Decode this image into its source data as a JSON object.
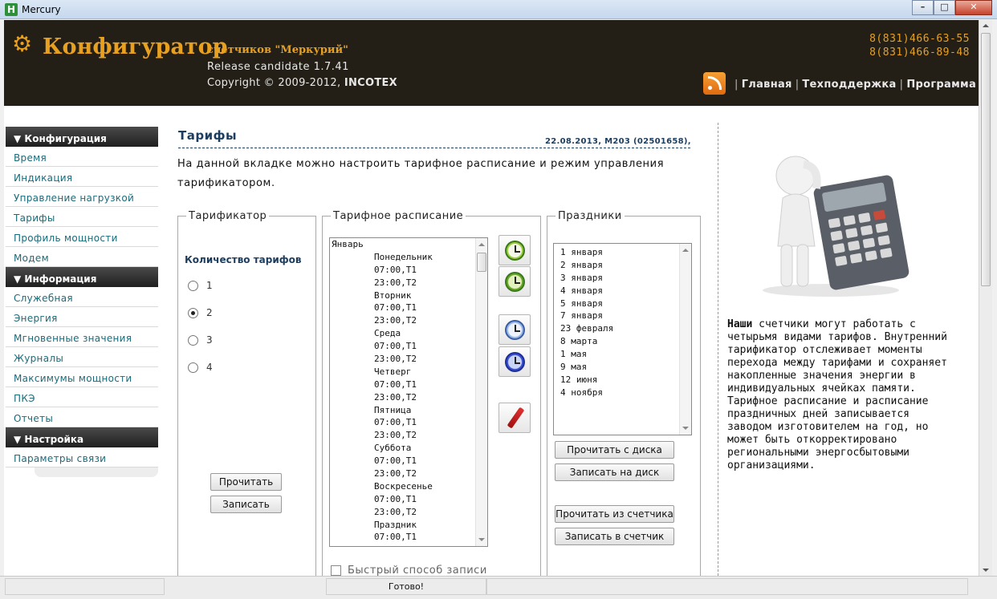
{
  "window": {
    "title": "Mercury",
    "app_icon_letter": "H",
    "buttons": {
      "minimize": "–",
      "maximize": "□",
      "close": "✕"
    }
  },
  "header": {
    "brand": "Конфигуратор",
    "subtitle": "счетчиков \"Меркурий\"",
    "release": "Release candidate 1.7.41",
    "copyright_prefix": "Copyright © 2009-2012, ",
    "copyright_company": "INCOTEX",
    "phones": [
      "8(831)466-63-55",
      "8(831)466-89-48"
    ],
    "nav": [
      "Главная",
      "Техподдержка",
      "Программа"
    ]
  },
  "sidebar": {
    "sections": [
      {
        "title": "▼ Конфигурация",
        "items": [
          "Время",
          "Индикация",
          "Управление нагрузкой",
          "Тарифы",
          "Профиль мощности",
          "Модем"
        ]
      },
      {
        "title": "▼ Информация",
        "items": [
          "Служебная",
          "Энергия",
          "Мгновенные значения",
          "Журналы",
          "Максимумы мощности",
          "ПКЭ",
          "Отчеты"
        ]
      },
      {
        "title": "▼ Настройка",
        "items": [
          "Параметры связи"
        ]
      }
    ]
  },
  "main": {
    "title": "Тарифы",
    "meta": "22.08.2013, М203 (02501658),",
    "intro": "На данной вкладке можно настроить тарифное расписание и режим управления тарификатором.",
    "tarifikator": {
      "legend": "Тарификатор",
      "qty_label": "Количество тарифов",
      "options": [
        "1",
        "2",
        "3",
        "4"
      ],
      "selected": "2",
      "read_button": "Прочитать",
      "write_button": "Записать"
    },
    "schedule": {
      "legend": "Тарифное расписание",
      "lines": [
        "Январь",
        "        Понедельник",
        "        07:00,T1",
        "        23:00,T2",
        "        Вторник",
        "        07:00,T1",
        "        23:00,T2",
        "        Среда",
        "        07:00,T1",
        "        23:00,T2",
        "        Четверг",
        "        07:00,T1",
        "        23:00,T2",
        "        Пятница",
        "        07:00,T1",
        "        23:00,T2",
        "        Суббота",
        "        07:00,T1",
        "        23:00,T2",
        "        Воскресенье",
        "        07:00,T1",
        "        23:00,T2",
        "        Праздник",
        "        07:00,T1"
      ],
      "fast_write": "Быстрый способ записи"
    },
    "holidays": {
      "legend": "Праздники",
      "items": [
        "1 января",
        "2 января",
        "3 января",
        "4 января",
        "5 января",
        "7 января",
        "23 февраля",
        "8 марта",
        "1 мая",
        "9 мая",
        "12 июня",
        "4 ноября"
      ],
      "read_disk": "Прочитать с диска",
      "write_disk": "Записать на диск",
      "read_meter": "Прочитать из счетчика",
      "write_meter": "Записать в счетчик"
    },
    "promo": {
      "bold": "Наши",
      "text": " счетчики могут работать с четырьмя видами тарифов. Внутренний тарификатор отслеживает моменты перехода между тарифами и сохраняет накопленные значения энергии в индивидуальных ячейках памяти. Тарифное расписание и расписание праздничных дней записывается заводом изготовителем на год, но может быть откорректировано региональными энергосбытовыми организациями."
    }
  },
  "status": {
    "text": "Готово!"
  },
  "colors": {
    "header_bg": "#231f16",
    "brand": "#e8a020",
    "link": "#1a6b7a",
    "title": "#1d3d5e"
  }
}
